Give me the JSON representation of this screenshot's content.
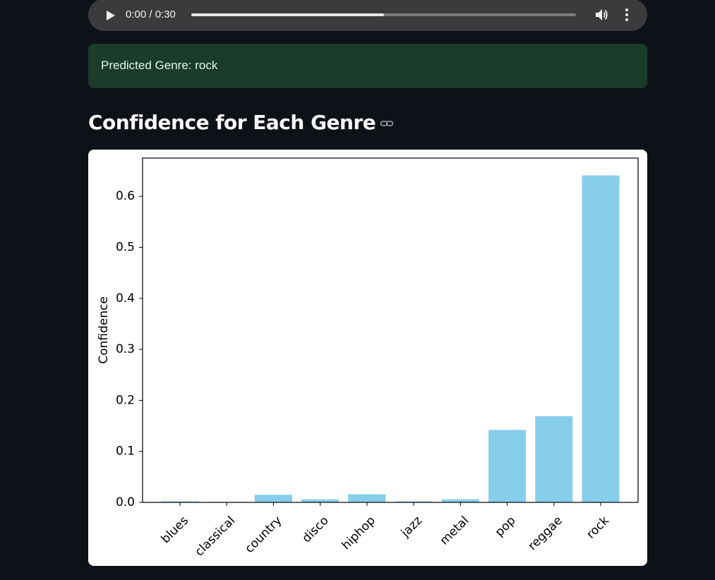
{
  "audio": {
    "time_display": "0:00 / 0:30",
    "progress": 0.5
  },
  "alert": {
    "text": "Predicted Genre: rock",
    "color": "#1b3b2b"
  },
  "section": {
    "title": "Confidence for Each Genre",
    "link_icon": "link-icon"
  },
  "chart_data": {
    "type": "bar",
    "title": "",
    "xlabel": "",
    "ylabel": "Confidence",
    "categories": [
      "blues",
      "classical",
      "country",
      "disco",
      "hiphop",
      "jazz",
      "metal",
      "pop",
      "reggae",
      "rock"
    ],
    "values": [
      0.002,
      0.001,
      0.015,
      0.006,
      0.016,
      0.002,
      0.006,
      0.142,
      0.169,
      0.641
    ],
    "ylim": [
      0,
      0.675
    ],
    "yticks": [
      0.0,
      0.1,
      0.2,
      0.3,
      0.4,
      0.5,
      0.6
    ],
    "ytick_labels": [
      "0.0",
      "0.1",
      "0.2",
      "0.3",
      "0.4",
      "0.5",
      "0.6"
    ],
    "bar_color": "#87ceeb",
    "grid": false
  }
}
